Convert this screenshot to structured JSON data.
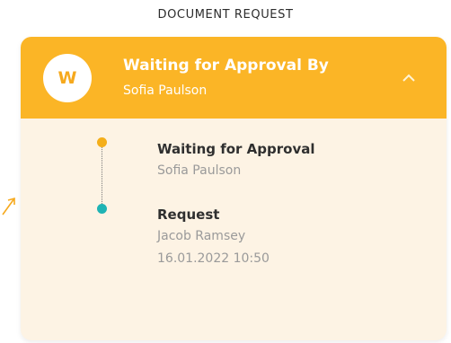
{
  "section_title": "DOCUMENT REQUEST",
  "card": {
    "avatar_initial": "W",
    "header_title": "Waiting for Approval By",
    "header_subtitle": "Sofia Paulson",
    "chevron_icon": "chevron-up-icon"
  },
  "timeline": [
    {
      "title": "Waiting for Approval",
      "person": "Sofia Paulson",
      "dot_color": "#f4ae1a"
    },
    {
      "title": "Request",
      "person": "Jacob Ramsey",
      "timestamp": "16.01.2022 10:50",
      "dot_color": "#1fb3b4"
    }
  ],
  "colors": {
    "header_bg": "#fbb526",
    "card_bg": "#fdf3e4",
    "accent": "#f4ae1a",
    "secondary": "#1fb3b4"
  }
}
